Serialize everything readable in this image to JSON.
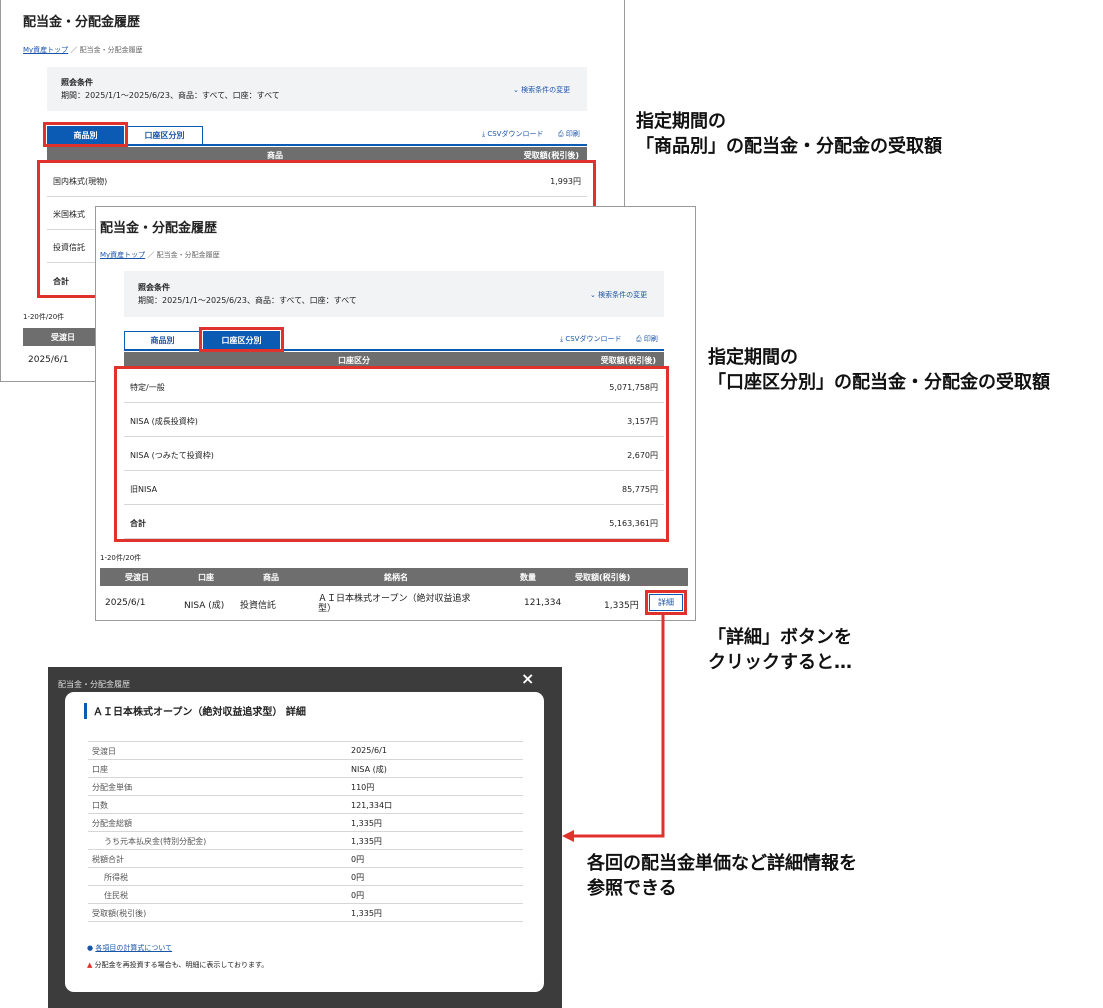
{
  "back_screen": {
    "title": "配当金・分配金履歴",
    "breadcrumb": {
      "home": "My資産トップ",
      "sep": "／",
      "current": "配当金・分配金履歴"
    },
    "conditions": {
      "label": "照会条件",
      "text": "期間：2025/1/1～2025/6/23、商品：すべて、口座：すべて",
      "change_link": "検索条件の変更"
    },
    "tabs": [
      {
        "label": "商品別"
      },
      {
        "label": "口座区分別"
      }
    ],
    "tools": {
      "csv": "CSVダウンロード",
      "print": "印刷"
    },
    "table": {
      "headers": [
        "商品",
        "受取額(税引後)"
      ],
      "rows": [
        {
          "name": "国内株式(現物)",
          "amount": "1,993円"
        },
        {
          "name": "米国株式",
          "amount": ""
        },
        {
          "name": "投資信託",
          "amount": ""
        }
      ],
      "total_label": "合計"
    },
    "count": "1-20件/20件",
    "detail_header_first": "受渡日",
    "detail_first_cell": "2025/6/1"
  },
  "front_screen": {
    "title": "配当金・分配金履歴",
    "breadcrumb": {
      "home": "My資産トップ",
      "sep": "／",
      "current": "配当金・分配金履歴"
    },
    "conditions": {
      "label": "照会条件",
      "text": "期間：2025/1/1～2025/6/23、商品：すべて、口座：すべて",
      "change_link": "検索条件の変更"
    },
    "tabs": [
      {
        "label": "商品別"
      },
      {
        "label": "口座区分別"
      }
    ],
    "tools": {
      "csv": "CSVダウンロード",
      "print": "印刷"
    },
    "table": {
      "headers": [
        "口座区分",
        "受取額(税引後)"
      ],
      "rows": [
        {
          "name": "特定/一般",
          "amount": "5,071,758円"
        },
        {
          "name": "NISA (成長投資枠)",
          "amount": "3,157円"
        },
        {
          "name": "NISA (つみたて投資枠)",
          "amount": "2,670円"
        },
        {
          "name": "旧NISA",
          "amount": "85,775円"
        }
      ],
      "total_label": "合計",
      "total_amount": "5,163,361円"
    },
    "count": "1-20件/20件",
    "detail_table": {
      "headers": [
        "受渡日",
        "口座",
        "商品",
        "銘柄名",
        "数量",
        "受取額(税引後)"
      ],
      "row": {
        "date": "2025/6/1",
        "account": "NISA (成)",
        "product": "投資信託",
        "fund_line1": "ＡＩ日本株式オープン（絶対収益追求",
        "fund_line2": "型）",
        "quantity": "121,334",
        "amount": "1,335円",
        "detail_button": "詳細"
      }
    }
  },
  "annotations": {
    "by_product": [
      "指定期間の",
      "「商品別」の配当金・分配金の受取額"
    ],
    "by_account": [
      "指定期間の",
      "「口座区分別」の配当金・分配金の受取額"
    ],
    "detail_click": [
      "「詳細」ボタンを",
      "クリックすると…"
    ],
    "detail_info": [
      "各回の配当金単価など詳細情報を",
      "参照できる"
    ]
  },
  "modal": {
    "close_glyph": "×",
    "title": "ＡＩ日本株式オープン（絶対収益追求型） 詳細",
    "rows": [
      {
        "label": "受渡日",
        "value": "2025/6/1",
        "indent": false
      },
      {
        "label": "口座",
        "value": "NISA (成)",
        "indent": false
      },
      {
        "label": "分配金単価",
        "value": "110円",
        "indent": false
      },
      {
        "label": "口数",
        "value": "121,334口",
        "indent": false
      },
      {
        "label": "分配金総額",
        "value": "1,335円",
        "indent": false
      },
      {
        "label": "うち元本払戻金(特別分配金)",
        "value": "1,335円",
        "indent": true
      },
      {
        "label": "税額合計",
        "value": "0円",
        "indent": false
      },
      {
        "label": "所得税",
        "value": "0円",
        "indent": true
      },
      {
        "label": "住民税",
        "value": "0円",
        "indent": true
      },
      {
        "label": "受取額(税引後)",
        "value": "1,335円",
        "indent": false
      }
    ],
    "help_link": "各項目の計算式について",
    "warning": "分配金を再投資する場合も、明細に表示しております。"
  },
  "colors": {
    "accent": "#0b5bb5",
    "highlight": "#e0322d",
    "header_gray": "#6e6e6e"
  }
}
